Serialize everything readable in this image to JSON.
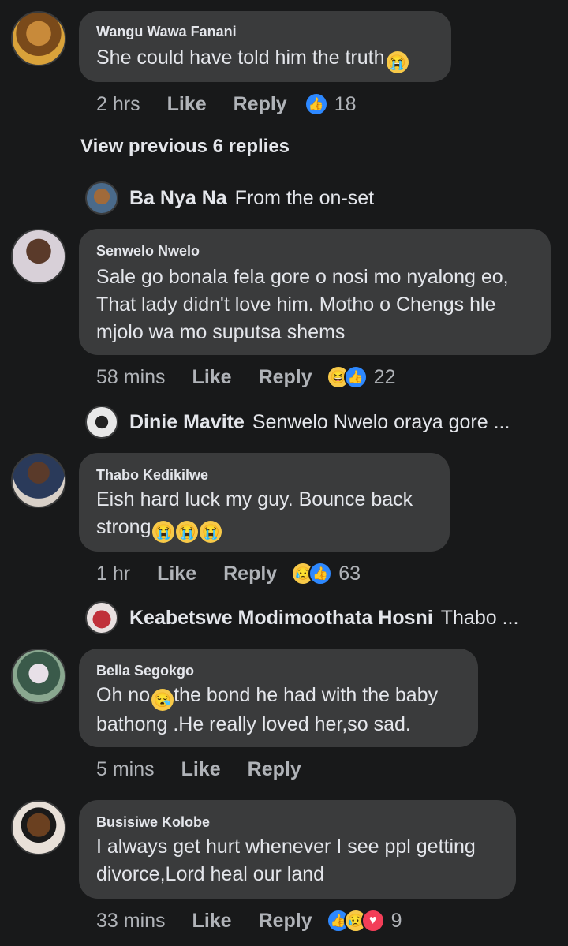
{
  "comments": [
    {
      "author": "Wangu Wawa Fanani",
      "text": "She could have told him the truth",
      "time": "2 hrs",
      "like": "Like",
      "reply": "Reply",
      "reaction_count": "18"
    },
    {
      "author": "Senwelo Nwelo",
      "text_lines": [
        "Sale go bonala fela gore o nosi mo nyalong eo,",
        "That lady didn't love him. Motho o Chengs hle",
        "mjolo wa mo suputsa shems"
      ],
      "time": "58 mins",
      "like": "Like",
      "reply": "Reply",
      "reaction_count": "22"
    },
    {
      "author": "Thabo Kedikilwe",
      "text_lines": [
        "Eish hard luck my guy. Bounce back",
        "strong"
      ],
      "time": "1 hr",
      "like": "Like",
      "reply": "Reply",
      "reaction_count": "63"
    },
    {
      "author": "Bella Segokgo",
      "text_lines": [
        "Oh no",
        "the bond he had with the baby",
        "bathong .He really loved her,so sad."
      ],
      "time": "5 mins",
      "like": "Like",
      "reply": "Reply"
    },
    {
      "author": "Busisiwe Kolobe",
      "text_lines": [
        "I always get hurt whenever I see ppl getting",
        "divorce,Lord heal our land"
      ],
      "time": "33 mins",
      "like": "Like",
      "reply": "Reply",
      "reaction_count": "9"
    }
  ],
  "view_previous": "View previous 6 replies",
  "replies": [
    {
      "name": "Ba Nya Na",
      "text": "From the on-set"
    },
    {
      "name": "Dinie Mavite",
      "text": "Senwelo Nwelo oraya gore ..."
    },
    {
      "name": "Keabetswe Modimoothata Hosni",
      "text": "Thabo ..."
    }
  ],
  "colors": {
    "background": "#18191a",
    "bubble": "#3a3b3c",
    "like_blue": "#2d88ff",
    "love_red": "#f33e58",
    "emoji_yellow": "#f7c948"
  }
}
